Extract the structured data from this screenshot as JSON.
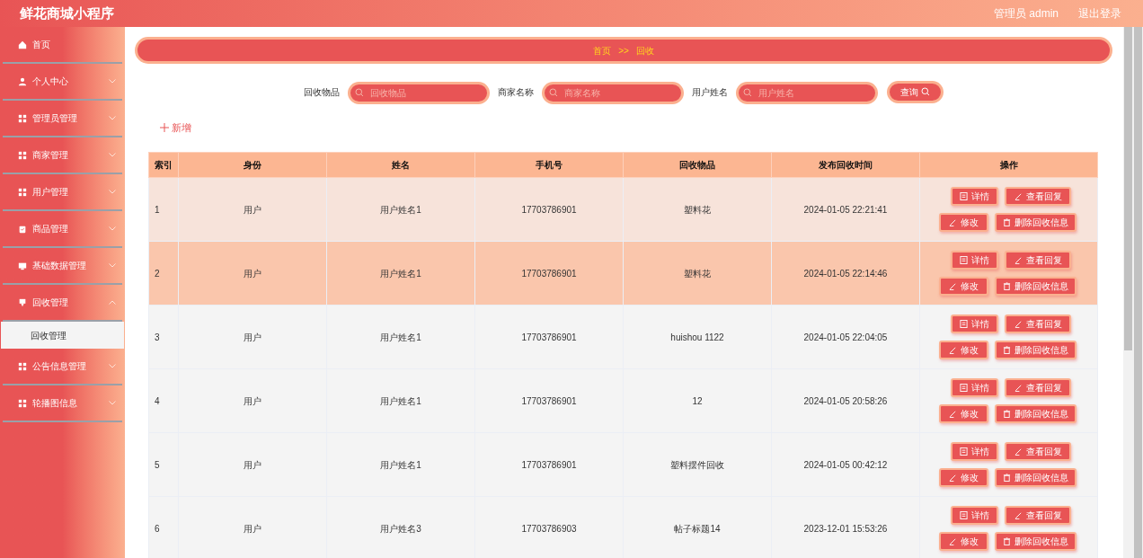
{
  "header": {
    "title": "鲜花商城小程序",
    "user": "管理员 admin",
    "logout": "退出登录"
  },
  "sidebar": {
    "items": [
      {
        "label": "首页"
      },
      {
        "label": "个人中心",
        "expanded": false
      },
      {
        "label": "管理员管理",
        "expanded": false
      },
      {
        "label": "商家管理",
        "expanded": false
      },
      {
        "label": "用户管理",
        "expanded": false
      },
      {
        "label": "商品管理",
        "expanded": false
      },
      {
        "label": "基础数据管理",
        "expanded": false
      },
      {
        "label": "回收管理",
        "expanded": true,
        "children": [
          {
            "label": "回收管理",
            "selected": true
          }
        ]
      },
      {
        "label": "公告信息管理",
        "expanded": false
      },
      {
        "label": "轮播图信息",
        "expanded": false
      }
    ]
  },
  "breadcrumb": {
    "home": "首页",
    "separator": ">>",
    "current": "回收"
  },
  "search": {
    "fields": [
      {
        "label": "回收物品",
        "placeholder": "回收物品"
      },
      {
        "label": "商家名称",
        "placeholder": "商家名称"
      },
      {
        "label": "用户姓名",
        "placeholder": "用户姓名"
      }
    ],
    "button": "查询"
  },
  "add_button": "新增",
  "table": {
    "columns": [
      "索引",
      "身份",
      "姓名",
      "手机号",
      "回收物品",
      "发布回收时间",
      "操作"
    ],
    "rows": [
      {
        "cells": [
          "1",
          "用户",
          "用户姓名1",
          "17703786901",
          "塑料花",
          "2024-01-05 22:21:41"
        ],
        "actions": [
          "详情",
          "查看回复",
          "修改",
          "删除回收信息"
        ],
        "hovered": true,
        "selected": false
      },
      {
        "cells": [
          "2",
          "用户",
          "用户姓名1",
          "17703786901",
          "塑料花",
          "2024-01-05 22:14:46"
        ],
        "actions": [
          "详情",
          "查看回复",
          "修改",
          "删除回收信息"
        ],
        "hovered": false,
        "selected": true
      },
      {
        "cells": [
          "3",
          "用户",
          "用户姓名1",
          "17703786901",
          "huishou 1122",
          "2024-01-05 22:04:05"
        ],
        "actions": [
          "详情",
          "查看回复",
          "修改",
          "删除回收信息"
        ],
        "hovered": false,
        "selected": false
      },
      {
        "cells": [
          "4",
          "用户",
          "用户姓名1",
          "17703786901",
          "12",
          "2024-01-05 20:58:26"
        ],
        "actions": [
          "详情",
          "查看回复",
          "修改",
          "删除回收信息"
        ],
        "hovered": false,
        "selected": false
      },
      {
        "cells": [
          "5",
          "用户",
          "用户姓名1",
          "17703786901",
          "塑料摆件回收",
          "2024-01-05 00:42:12"
        ],
        "actions": [
          "详情",
          "查看回复",
          "修改",
          "删除回收信息"
        ],
        "hovered": false,
        "selected": false
      },
      {
        "cells": [
          "6",
          "用户",
          "用户姓名3",
          "17703786903",
          "帖子标题14",
          "2023-12-01 15:53:26"
        ],
        "actions": [
          "详情",
          "查看回复",
          "修改",
          "删除回收信息"
        ],
        "hovered": false,
        "selected": false
      }
    ]
  }
}
